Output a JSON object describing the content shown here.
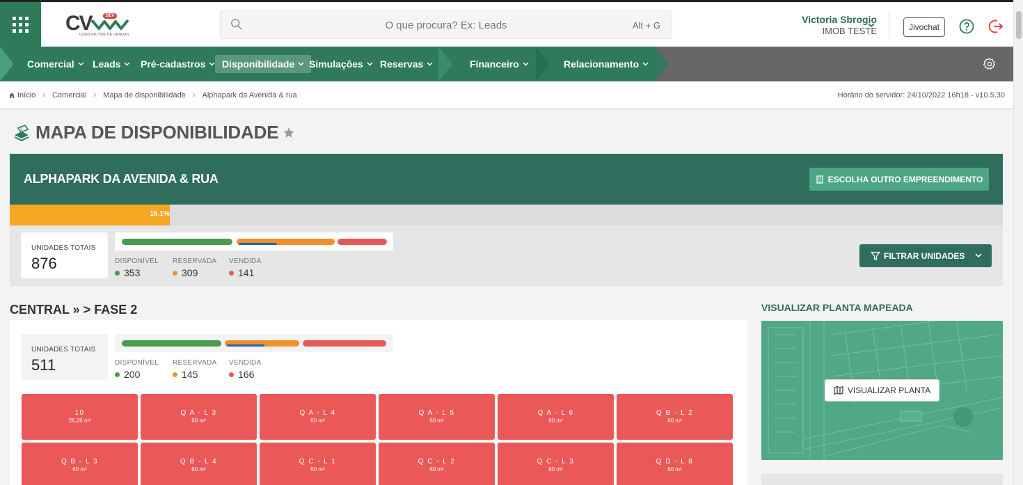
{
  "header": {
    "logo_text": "CV",
    "logo_badge": "DEV",
    "logo_subtitle": "CONSTRUTOR DE VENDAS",
    "search_placeholder": "O que procura? Ex: Leads",
    "search_shortcut": "Alt + G",
    "user_name": "Victoria Sbrogio",
    "user_company": "IMOB TESTE",
    "jivochat_label": "Jivochat"
  },
  "nav": {
    "items": [
      {
        "label": "Comercial"
      },
      {
        "label": "Leads"
      },
      {
        "label": "Pré-cadastros"
      },
      {
        "label": "Disponibilidade",
        "active": true
      },
      {
        "label": "Simulações"
      },
      {
        "label": "Reservas"
      },
      {
        "label": "Financeiro"
      },
      {
        "label": "Relacionamento"
      }
    ]
  },
  "breadcrumb": {
    "items": [
      "Início",
      "Comercial",
      "Mapa de disponibilidade",
      "Alphapark da Avenida & rua"
    ],
    "server_time": "Horário do servidor: 24/10/2022 16h18 - v10.5.30"
  },
  "page": {
    "title": "MAPA DE DISPONIBILIDADE"
  },
  "enterprise": {
    "name": "ALPHAPARK DA AVENIDA & RUA",
    "change_button": "ESCOLHA OUTRO EMPREENDIMENTO",
    "progress_label": "16.1%",
    "progress_value": 16.1,
    "summary": {
      "total_label": "UNIDADES TOTAIS",
      "total_value": "876",
      "available_label": "DISPONÍVEL",
      "available_value": "353",
      "reserved_label": "RESERVADA",
      "reserved_value": "309",
      "sold_label": "VENDIDA",
      "sold_value": "141"
    },
    "filter_button": "FILTRAR UNIDADES"
  },
  "section": {
    "title": "CENTRAL » > FASE 2",
    "summary": {
      "total_label": "UNIDADES TOTAIS",
      "total_value": "511",
      "available_label": "DISPONÍVEL",
      "available_value": "200",
      "reserved_label": "RESERVADA",
      "reserved_value": "145",
      "sold_label": "VENDIDA",
      "sold_value": "166"
    },
    "units": [
      {
        "code": "10",
        "area": "26,26 m²"
      },
      {
        "code": "Q A - L 3",
        "area": "60 m²"
      },
      {
        "code": "Q A - L 4",
        "area": "60 m²"
      },
      {
        "code": "Q A - L 5",
        "area": "60 m²"
      },
      {
        "code": "Q A - L 6",
        "area": "60 m²"
      },
      {
        "code": "Q B - L 2",
        "area": "60 m²"
      },
      {
        "code": "Q B - L 3",
        "area": "60 m²"
      },
      {
        "code": "Q B - L 4",
        "area": "60 m²"
      },
      {
        "code": "Q C - L 1",
        "area": "60 m²"
      },
      {
        "code": "Q C - L 2",
        "area": "60 m²"
      },
      {
        "code": "Q C - L 3",
        "area": "60 m²"
      },
      {
        "code": "Q D - L 8",
        "area": "60 m²"
      }
    ]
  },
  "map": {
    "title": "VISUALIZAR PLANTA MAPEADA",
    "button": "VISUALIZAR PLANTA"
  },
  "colors": {
    "brand_green": "#2e7a5b",
    "panel_green": "#2f6d5d",
    "available": "#4a9a4f",
    "reserved": "#f0912b",
    "sold": "#e35a5a",
    "progress": "#f5a623",
    "unit_sold": "#ea5858"
  },
  "icons": [
    "apps-grid-icon",
    "search-icon",
    "chevron-down-icon",
    "help-icon",
    "logout-icon",
    "gear-icon",
    "home-icon",
    "money-stack-icon",
    "star-icon",
    "building-icon",
    "filter-icon",
    "map-icon"
  ]
}
